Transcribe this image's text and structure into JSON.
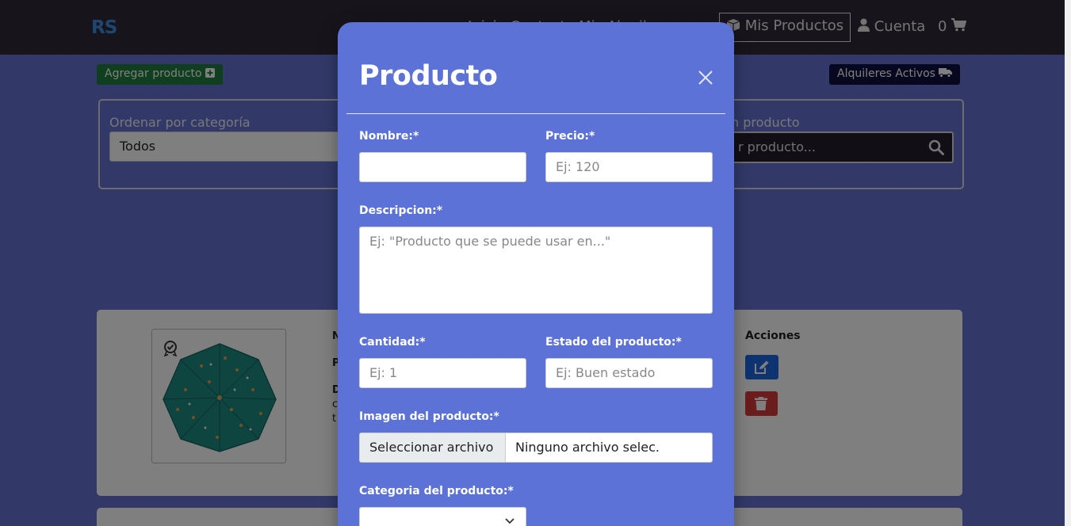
{
  "nav": {
    "brand": "RS",
    "hidden_links": "Inicio  Contacto  Mis Alquileres",
    "mis_productos": "Mis Productos",
    "cuenta": "Cuenta",
    "cart_count": "0"
  },
  "page": {
    "add_product_label": "Agregar producto",
    "rentals_label": "Alquileres Activos",
    "filter": {
      "category_label": "Ordenar por categoría",
      "category_value": "Todos",
      "search_label": "n producto",
      "search_placeholder": "r producto..."
    },
    "card": {
      "frag_n": "N",
      "frag_p": "P",
      "frag_d": "D",
      "frag_c": "c",
      "frag_t": "t",
      "acciones_label": "Acciones"
    }
  },
  "modal": {
    "title": "Producto",
    "nombre_label": "Nombre:*",
    "nombre_value": "",
    "precio_label": "Precio:*",
    "precio_placeholder": "Ej: 120",
    "descripcion_label": "Descripcion:*",
    "descripcion_placeholder": "Ej: \"Producto que se puede usar en...\"",
    "cantidad_label": "Cantidad:*",
    "cantidad_placeholder": "Ej: 1",
    "estado_label": "Estado del producto:*",
    "estado_placeholder": "Ej: Buen estado",
    "imagen_label": "Imagen del producto:*",
    "file_button": "Seleccionar archivo",
    "file_name": "Ninguno archivo selec.",
    "categoria_label": "Categoria del producto:*",
    "categoria_value": ""
  },
  "colors": {
    "page_bg": "#6473d0",
    "navbar": "#2f2b37",
    "modal_bg": "#5c72d6",
    "add_button": "#1e7f3f",
    "rentals_button": "#0f1140",
    "edit_button": "#1a66e0",
    "delete_button": "#d63b3b"
  },
  "icons": [
    "plus-square-icon",
    "truck-icon",
    "box-icon",
    "user-icon",
    "cart-icon",
    "search-icon",
    "umbrella-image",
    "badge-icon",
    "edit-icon",
    "trash-icon",
    "close-icon",
    "chevron-down-icon"
  ]
}
